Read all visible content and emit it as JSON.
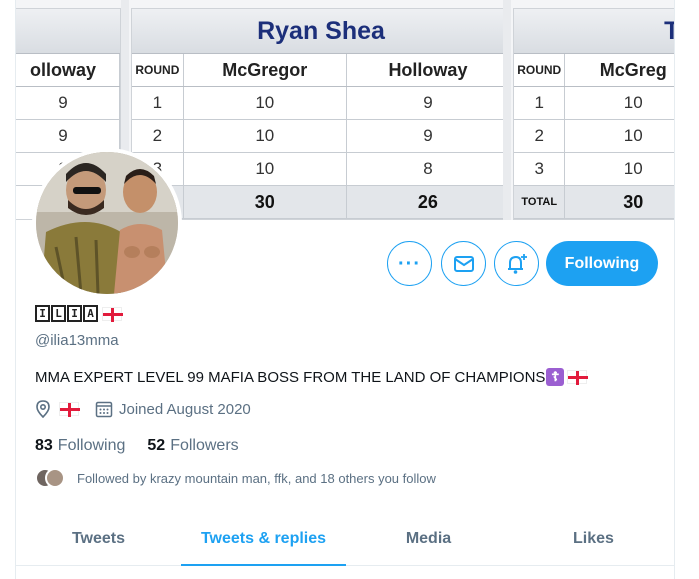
{
  "banner": {
    "left_card": {
      "col_header": "olloway",
      "rows": [
        "9",
        "9",
        "9"
      ]
    },
    "mid_card": {
      "title": "Ryan Shea",
      "col_round": "ROUND",
      "col_a": "McGregor",
      "col_b": "Holloway",
      "rows": [
        {
          "round": "1",
          "a": "10",
          "b": "9"
        },
        {
          "round": "2",
          "a": "10",
          "b": "9"
        },
        {
          "round": "3",
          "a": "10",
          "b": "8"
        }
      ],
      "total": {
        "label": "",
        "a": "30",
        "b": "26"
      }
    },
    "right_card": {
      "title": "Tony",
      "col_round": "ROUND",
      "col_a": "McGreg",
      "rows": [
        {
          "round": "1",
          "a": "10"
        },
        {
          "round": "2",
          "a": "10"
        },
        {
          "round": "3",
          "a": "10"
        }
      ],
      "total": {
        "label": "TOTAL",
        "a": "30"
      }
    }
  },
  "profile": {
    "name_chars": [
      "I",
      "L",
      "I",
      "A"
    ],
    "handle": "@ilia13mma",
    "bio": "MMA EXPERT LEVEL 99 MAFIA BOSS FROM THE LAND OF CHAMPIONS",
    "bio_emoji": "☦",
    "joined": "Joined August 2020",
    "following_count": "83",
    "following_label": "Following",
    "followers_count": "52",
    "followers_label": "Followers",
    "followed_by": "Followed by krazy mountain man, ffk, and 18 others you follow"
  },
  "actions": {
    "follow_label": "Following"
  },
  "tabs": [
    {
      "label": "Tweets"
    },
    {
      "label": "Tweets & replies"
    },
    {
      "label": "Media"
    },
    {
      "label": "Likes"
    }
  ],
  "colors": {
    "accent": "#1da1f2",
    "flag_red": "#e21b3c"
  }
}
